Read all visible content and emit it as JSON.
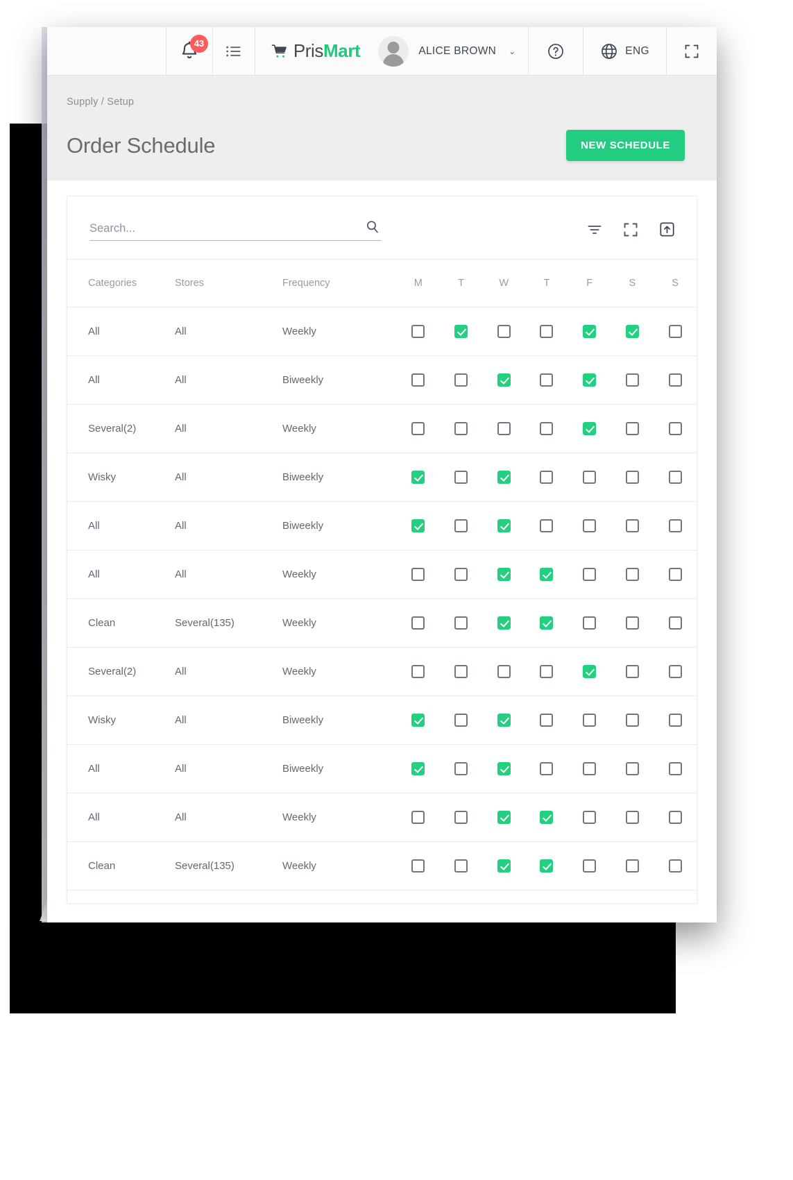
{
  "topbar": {
    "notifications_count": "43",
    "brand_first": "Pris",
    "brand_second": "Mart",
    "user_name": "ALICE BROWN",
    "language": "ENG",
    "caret": "⌄",
    "icons": {
      "bell": "bell-icon",
      "list": "list-icon",
      "cart": "shopping-cart-icon",
      "help": "help-circle-icon",
      "globe": "globe-icon",
      "fullscreen": "fullscreen-icon"
    }
  },
  "page": {
    "breadcrumb": "Supply / Setup",
    "title": "Order Schedule",
    "new_button": "NEW SCHEDULE"
  },
  "search": {
    "placeholder": "Search...",
    "value": ""
  },
  "toolbar": {
    "filter_icon": "filter-icon",
    "fullscreen_icon": "fullscreen-icon",
    "export_icon": "export-box-icon"
  },
  "colors": {
    "accent_green": "#22cd81",
    "checkbox_green": "#22d07f",
    "badge_red": "#ff5b5b",
    "page_bg": "#eeeeee",
    "text_muted": "#9a9aa4"
  },
  "table": {
    "columns": [
      "Categories",
      "Stores",
      "Frequency"
    ],
    "days": [
      "M",
      "T",
      "W",
      "T",
      "F",
      "S",
      "S"
    ],
    "rows": [
      {
        "category": "All",
        "stores": "All",
        "frequency": "Weekly",
        "days": [
          false,
          true,
          false,
          false,
          true,
          true,
          false
        ]
      },
      {
        "category": "All",
        "stores": "All",
        "frequency": "Biweekly",
        "days": [
          false,
          false,
          true,
          false,
          true,
          false,
          false
        ]
      },
      {
        "category": "Several(2)",
        "stores": "All",
        "frequency": "Weekly",
        "days": [
          false,
          false,
          false,
          false,
          true,
          false,
          false
        ]
      },
      {
        "category": "Wisky",
        "stores": "All",
        "frequency": "Biweekly",
        "days": [
          true,
          false,
          true,
          false,
          false,
          false,
          false
        ]
      },
      {
        "category": "All",
        "stores": "All",
        "frequency": "Biweekly",
        "days": [
          true,
          false,
          true,
          false,
          false,
          false,
          false
        ]
      },
      {
        "category": "All",
        "stores": "All",
        "frequency": "Weekly",
        "days": [
          false,
          false,
          true,
          true,
          false,
          false,
          false
        ]
      },
      {
        "category": "Clean",
        "stores": "Several(135)",
        "frequency": "Weekly",
        "days": [
          false,
          false,
          true,
          true,
          false,
          false,
          false
        ]
      },
      {
        "category": "Several(2)",
        "stores": "All",
        "frequency": "Weekly",
        "days": [
          false,
          false,
          false,
          false,
          true,
          false,
          false
        ]
      },
      {
        "category": "Wisky",
        "stores": "All",
        "frequency": "Biweekly",
        "days": [
          true,
          false,
          true,
          false,
          false,
          false,
          false
        ]
      },
      {
        "category": "All",
        "stores": "All",
        "frequency": "Biweekly",
        "days": [
          true,
          false,
          true,
          false,
          false,
          false,
          false
        ]
      },
      {
        "category": "All",
        "stores": "All",
        "frequency": "Weekly",
        "days": [
          false,
          false,
          true,
          true,
          false,
          false,
          false
        ]
      },
      {
        "category": "Clean",
        "stores": "Several(135)",
        "frequency": "Weekly",
        "days": [
          false,
          false,
          true,
          true,
          false,
          false,
          false
        ]
      }
    ]
  }
}
